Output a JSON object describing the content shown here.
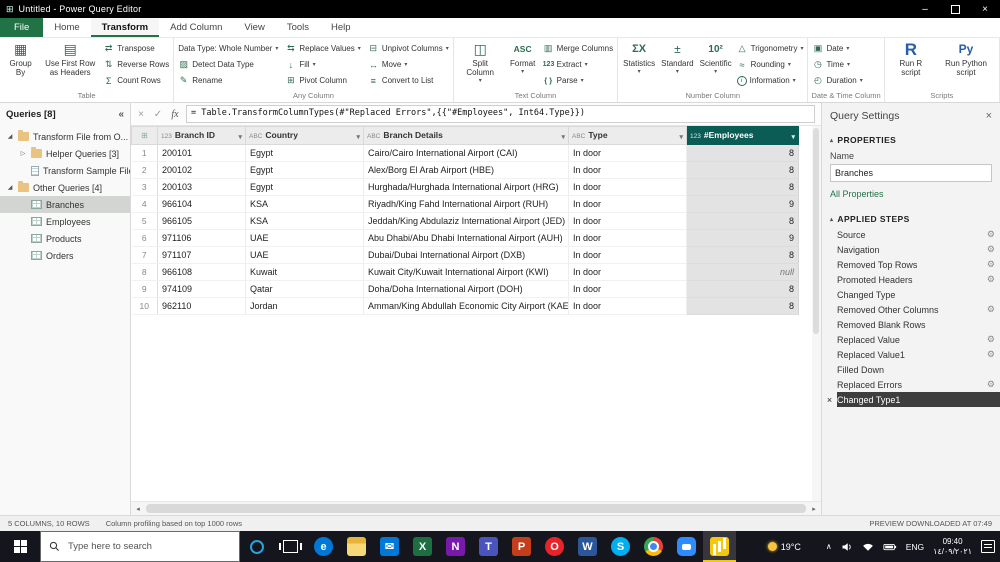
{
  "window": {
    "title": "Untitled - Power Query Editor",
    "minimize_glyph": "–",
    "close_glyph": "×"
  },
  "menubar": {
    "tabs": [
      "File",
      "Home",
      "Transform",
      "Add Column",
      "View",
      "Tools",
      "Help"
    ],
    "active_tab": "Transform",
    "file_tab": "File"
  },
  "ribbon": {
    "icon_glyphs": {
      "group-by": "▦",
      "first-row-headers": "▤",
      "transpose": "⇄",
      "reverse-rows": "⇅",
      "count-rows": "Σ",
      "detect-data-type": "▨",
      "rename": "✎",
      "replace-values": "⇆",
      "fill": "↓",
      "pivot-column": "⊞",
      "unpivot-columns": "⊟",
      "move": "↔",
      "convert-to-list": "≡",
      "split-column": "◫",
      "format": "ASC",
      "merge-columns": "▥",
      "extract": "123",
      "parse": "{ }",
      "statistics": "ΣΧ",
      "standard": "±",
      "scientific": "10²",
      "trigonometry": "△",
      "rounding": "≈",
      "information": "i",
      "date": "▣",
      "time": "◷",
      "duration": "◴",
      "r-script": "R",
      "py-script": "Py"
    },
    "groups": [
      {
        "label": "Table",
        "large": [
          {
            "label": "Group By",
            "icon": "group-by"
          },
          {
            "label": "Use First Row as Headers",
            "icon": "first-row-headers"
          }
        ],
        "small": [
          {
            "label": "Transpose",
            "icon": "transpose"
          },
          {
            "label": "Reverse Rows",
            "icon": "reverse-rows"
          },
          {
            "label": "Count Rows",
            "icon": "count-rows"
          }
        ]
      },
      {
        "label": "Any Column",
        "large": [],
        "small": [
          {
            "label": "Data Type: Whole Number",
            "dropdown": true
          },
          {
            "label": "Detect Data Type",
            "icon": "detect-data-type"
          },
          {
            "label": "Rename",
            "icon": "rename"
          },
          {
            "label": "Replace Values",
            "icon": "replace-values",
            "dropdown": true
          },
          {
            "label": "Fill",
            "icon": "fill",
            "dropdown": true
          },
          {
            "label": "Pivot Column",
            "icon": "pivot-column"
          },
          {
            "label": "Unpivot Columns",
            "icon": "unpivot-columns",
            "dropdown": true
          },
          {
            "label": "Move",
            "icon": "move",
            "dropdown": true
          },
          {
            "label": "Convert to List",
            "icon": "convert-to-list"
          }
        ]
      },
      {
        "label": "Text Column",
        "large": [
          {
            "label": "Split Column",
            "icon": "split-column",
            "dropdown": true
          },
          {
            "label": "Format",
            "icon": "format",
            "dropdown": true
          }
        ],
        "small": [
          {
            "label": "Merge Columns",
            "icon": "merge-columns"
          },
          {
            "label": "Extract",
            "icon": "extract",
            "dropdown": true
          },
          {
            "label": "Parse",
            "icon": "parse",
            "dropdown": true
          }
        ]
      },
      {
        "label": "Number Column",
        "large": [
          {
            "label": "Statistics",
            "icon": "statistics",
            "dropdown": true
          },
          {
            "label": "Standard",
            "icon": "standard",
            "dropdown": true
          },
          {
            "label": "Scientific",
            "icon": "scientific",
            "dropdown": true
          }
        ],
        "small": [
          {
            "label": "Trigonometry",
            "icon": "trigonometry",
            "dropdown": true
          },
          {
            "label": "Rounding",
            "icon": "rounding",
            "dropdown": true
          },
          {
            "label": "Information",
            "icon": "information",
            "dropdown": true
          }
        ]
      },
      {
        "label": "Date & Time Column",
        "large": [],
        "small": [
          {
            "label": "Date",
            "icon": "date",
            "dropdown": true
          },
          {
            "label": "Time",
            "icon": "time",
            "dropdown": true
          },
          {
            "label": "Duration",
            "icon": "duration",
            "dropdown": true
          }
        ]
      },
      {
        "label": "Scripts",
        "large": [
          {
            "label": "Run R script",
            "icon": "r-script"
          },
          {
            "label": "Run Python script",
            "icon": "py-script"
          }
        ],
        "small": []
      }
    ]
  },
  "queries_panel": {
    "title": "Queries [8]",
    "collapse_icon": "«",
    "items": [
      {
        "label": "Transform File from O...",
        "icon": "folder",
        "indent": 0,
        "expander": "expanded"
      },
      {
        "label": "Helper Queries [3]",
        "icon": "folder",
        "indent": 1,
        "expander": "collapsed"
      },
      {
        "label": "Transform Sample File",
        "icon": "sheet",
        "indent": 1
      },
      {
        "label": "Other Queries [4]",
        "icon": "folder",
        "indent": 0,
        "expander": "expanded"
      },
      {
        "label": "Branches",
        "icon": "table",
        "indent": 1,
        "selected": true
      },
      {
        "label": "Employees",
        "icon": "table",
        "indent": 1
      },
      {
        "label": "Products",
        "icon": "table",
        "indent": 1
      },
      {
        "label": "Orders",
        "icon": "table",
        "indent": 1
      }
    ]
  },
  "formula_bar": {
    "cancel_icon": "×",
    "commit_icon": "✓",
    "fx_icon": "fx",
    "formula": "= Table.TransformColumnTypes(#\"Replaced Errors\",{{\"#Employees\", Int64.Type}})"
  },
  "grid": {
    "corner_icon": "⊞",
    "columns": [
      {
        "name": "Branch ID",
        "type_icon": "123",
        "align": "left"
      },
      {
        "name": "Country",
        "type_icon": "ABC",
        "align": "left"
      },
      {
        "name": "Branch Details",
        "type_icon": "ABC",
        "align": "left"
      },
      {
        "name": "Type",
        "type_icon": "ABC",
        "align": "left"
      },
      {
        "name": "#Employees",
        "type_icon": "123",
        "align": "right",
        "selected": true
      }
    ],
    "rows": [
      [
        "200101",
        "Egypt",
        "Cairo/Cairo International Airport (CAI)",
        "In door",
        "8"
      ],
      [
        "200102",
        "Egypt",
        "Alex/Borg El Arab Airport (HBE)",
        "In door",
        "8"
      ],
      [
        "200103",
        "Egypt",
        "Hurghada/Hurghada International Airport (HRG)",
        "In door",
        "8"
      ],
      [
        "966104",
        "KSA",
        "Riyadh/King Fahd International Airport (RUH)",
        "In door",
        "9"
      ],
      [
        "966105",
        "KSA",
        "Jeddah/King Abdulaziz International Airport (JED)",
        "In door",
        "8"
      ],
      [
        "971106",
        "UAE",
        "Abu Dhabi/Abu Dhabi International Airport (AUH)",
        "In door",
        "9"
      ],
      [
        "971107",
        "UAE",
        "Dubai/Dubai International Airport (DXB)",
        "In door",
        "8"
      ],
      [
        "966108",
        "Kuwait",
        "Kuwait City/Kuwait International Airport (KWI)",
        "In door",
        "null"
      ],
      [
        "974109",
        "Qatar",
        "Doha/Doha International Airport (DOH)",
        "In door",
        "8"
      ],
      [
        "962110",
        "Jordan",
        "Amman/King Abdullah Economic City Airport (KAEC)",
        "In door",
        "8"
      ]
    ]
  },
  "settings_panel": {
    "title": "Query Settings",
    "close_icon": "×",
    "properties": {
      "header": "PROPERTIES",
      "name_label": "Name",
      "name_value": "Branches",
      "all_properties": "All Properties"
    },
    "applied_steps": {
      "header": "APPLIED STEPS",
      "steps": [
        {
          "label": "Source",
          "gear": true
        },
        {
          "label": "Navigation",
          "gear": true
        },
        {
          "label": "Removed Top Rows",
          "gear": true
        },
        {
          "label": "Promoted Headers",
          "gear": true
        },
        {
          "label": "Changed Type",
          "gear": false
        },
        {
          "label": "Removed Other Columns",
          "gear": true
        },
        {
          "label": "Removed Blank Rows",
          "gear": false
        },
        {
          "label": "Replaced Value",
          "gear": true
        },
        {
          "label": "Replaced Value1",
          "gear": true
        },
        {
          "label": "Filled Down",
          "gear": false
        },
        {
          "label": "Replaced Errors",
          "gear": true
        },
        {
          "label": "Changed Type1",
          "gear": false,
          "selected": true,
          "delete_icon": "×"
        }
      ]
    }
  },
  "status_bar": {
    "left": "5 COLUMNS, 10 ROWS",
    "profiling": "Column profiling based on top 1000 rows",
    "right": "PREVIEW DOWNLOADED AT 07:49"
  },
  "taskbar": {
    "search_placeholder": "Type here to search",
    "apps": [
      {
        "name": "edge",
        "color": "#0078d7",
        "shape": "circle",
        "glyph": "e"
      },
      {
        "name": "file-explorer",
        "color": "#f5c74f",
        "shape": "square",
        "glyph": ""
      },
      {
        "name": "mail",
        "color": "#0078d7",
        "shape": "square",
        "glyph": "✉"
      },
      {
        "name": "excel",
        "color": "#1d6f42",
        "shape": "square",
        "glyph": "X"
      },
      {
        "name": "onenote",
        "color": "#7719aa",
        "shape": "square",
        "glyph": "N"
      },
      {
        "name": "teams",
        "color": "#4b53bc",
        "shape": "square",
        "glyph": "T"
      },
      {
        "name": "powerpoint",
        "color": "#c43e1c",
        "shape": "square",
        "glyph": "P"
      },
      {
        "name": "opera",
        "color": "#e8232a",
        "shape": "circle",
        "glyph": "O"
      },
      {
        "name": "word",
        "color": "#2b579a",
        "shape": "square",
        "glyph": "W"
      },
      {
        "name": "skype",
        "color": "#00aff0",
        "shape": "circle",
        "glyph": "S"
      },
      {
        "name": "chrome",
        "color": "",
        "shape": "circle",
        "glyph": ""
      },
      {
        "name": "zoom",
        "color": "#2d8cff",
        "shape": "square",
        "glyph": ""
      },
      {
        "name": "power-bi",
        "color": "#f2c811",
        "shape": "square",
        "glyph": "",
        "active": true
      }
    ],
    "weather": "19°C",
    "tray_icons": [
      "chevron-up-icon",
      "speaker-icon",
      "network-icon",
      "battery-icon",
      "notification-center-icon"
    ],
    "language": "ENG",
    "time": "09:40",
    "date": "١٤/٠٩/٢٠٢١"
  }
}
